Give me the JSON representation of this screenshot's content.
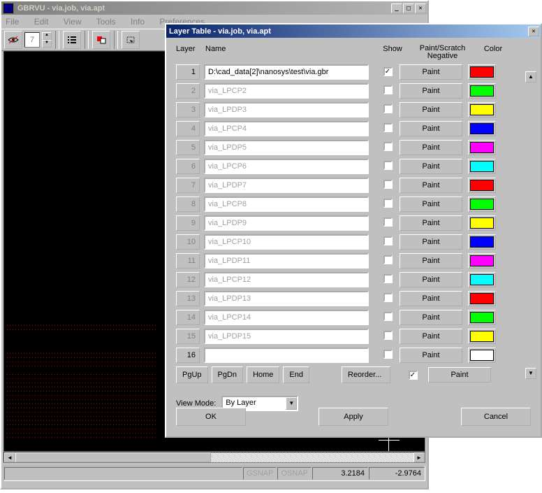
{
  "main_window": {
    "title": "GBRVU - via.job, via.apt",
    "menus": [
      "File",
      "Edit",
      "View",
      "Tools",
      "Info",
      "Preferences"
    ],
    "toolbar_spin": "7",
    "status": {
      "gsnap": "GSNAP",
      "osnap": "OSNAP",
      "x": "3.2184",
      "y": "-2.9764"
    }
  },
  "dialog": {
    "title": "Layer Table - via.job, via.apt",
    "headers": {
      "layer": "Layer",
      "name": "Name",
      "show": "Show",
      "paint": "Paint/Scratch\nNegative",
      "color": "Color"
    },
    "layers": [
      {
        "n": "1",
        "name": "D:\\cad_data[2]\\nanosys\\test\\via.gbr",
        "show": true,
        "paint": "Paint",
        "color": "#ff0000",
        "active": true
      },
      {
        "n": "2",
        "name": "via_LPCP2",
        "show": false,
        "paint": "Paint",
        "color": "#00ff00"
      },
      {
        "n": "3",
        "name": "via_LPDP3",
        "show": false,
        "paint": "Paint",
        "color": "#ffff00"
      },
      {
        "n": "4",
        "name": "via_LPCP4",
        "show": false,
        "paint": "Paint",
        "color": "#0000ff"
      },
      {
        "n": "5",
        "name": "via_LPDP5",
        "show": false,
        "paint": "Paint",
        "color": "#ff00ff"
      },
      {
        "n": "6",
        "name": "via_LPCP6",
        "show": false,
        "paint": "Paint",
        "color": "#00ffff"
      },
      {
        "n": "7",
        "name": "via_LPDP7",
        "show": false,
        "paint": "Paint",
        "color": "#ff0000"
      },
      {
        "n": "8",
        "name": "via_LPCP8",
        "show": false,
        "paint": "Paint",
        "color": "#00ff00"
      },
      {
        "n": "9",
        "name": "via_LPDP9",
        "show": false,
        "paint": "Paint",
        "color": "#ffff00"
      },
      {
        "n": "10",
        "name": "via_LPCP10",
        "show": false,
        "paint": "Paint",
        "color": "#0000ff"
      },
      {
        "n": "11",
        "name": "via_LPDP11",
        "show": false,
        "paint": "Paint",
        "color": "#ff00ff"
      },
      {
        "n": "12",
        "name": "via_LPCP12",
        "show": false,
        "paint": "Paint",
        "color": "#00ffff"
      },
      {
        "n": "13",
        "name": "via_LPDP13",
        "show": false,
        "paint": "Paint",
        "color": "#ff0000"
      },
      {
        "n": "14",
        "name": "via_LPCP14",
        "show": false,
        "paint": "Paint",
        "color": "#00ff00"
      },
      {
        "n": "15",
        "name": "via_LPDP15",
        "show": false,
        "paint": "Paint",
        "color": "#ffff00"
      },
      {
        "n": "16",
        "name": "",
        "show": false,
        "paint": "Paint",
        "color": "#ffffff",
        "active": true
      }
    ],
    "nav": {
      "pgup": "PgUp",
      "pgdn": "PgDn",
      "home": "Home",
      "end": "End",
      "reorder": "Reorder...",
      "all_paint": "Paint"
    },
    "view_mode_label": "View Mode:",
    "view_mode_value": "By Layer",
    "buttons": {
      "ok": "OK",
      "apply": "Apply",
      "cancel": "Cancel"
    }
  }
}
